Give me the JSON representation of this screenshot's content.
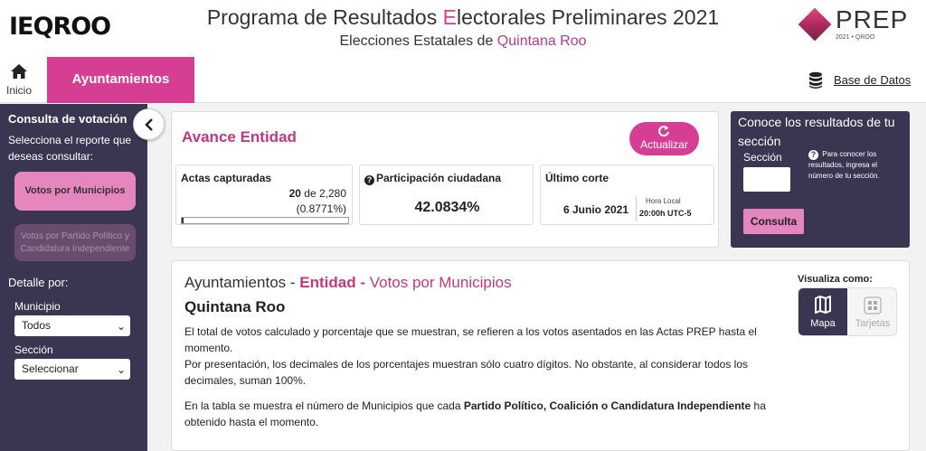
{
  "header": {
    "logo_text": "IEQROO",
    "title_before": "Programa de Resultados ",
    "title_accent": "E",
    "title_after": "lectorales Preliminares 2021",
    "subtitle_before": "Elecciones Estatales de ",
    "subtitle_accent": "Quintana Roo",
    "prep_logo_text": "PREP",
    "prep_logo_year": "2021  •  QROO"
  },
  "navbar": {
    "home_label": "Inicio",
    "active_tab": "Ayuntamientos",
    "database_link": "Base de Datos"
  },
  "sidebar": {
    "title": "Consulta de votación",
    "description": "Selecciona el reporte que deseas consultar:",
    "report_buttons": [
      {
        "label": "Votos por Municipios",
        "active": true
      },
      {
        "label": "Votos por Partido Político y Candidatura Independiente",
        "active": false
      }
    ],
    "detail_label": "Detalle por:",
    "municipio_label": "Municipio",
    "municipio_value": "Todos",
    "seccion_label": "Sección",
    "seccion_value": "Seleccionar"
  },
  "avance": {
    "title": "Avance Entidad",
    "update_button": "Actualizar",
    "actas_label": "Actas capturadas",
    "actas_count": "20",
    "actas_of": " de 2,280",
    "actas_pct": "(0.8771%)",
    "actas_progress": 0.008771,
    "participacion_label": "Participación ciudadana",
    "participacion_value": "42.0834%",
    "corte_label": "Último corte",
    "corte_date": "6 Junio 2021",
    "hora_label": "Hora Local",
    "hora_value": "20:00h UTC-5"
  },
  "conoce": {
    "title": "Conoce los resultados de tu sección",
    "seccion_label": "Sección",
    "help_text": "Para conocer los resultados, ingresa el número de tu sección.",
    "button": "Consulta"
  },
  "main": {
    "heading_prefix": "Ayuntamientos - ",
    "heading_entity": "Entidad",
    "heading_dash": " - ",
    "heading_suffix": "Votos por Municipios",
    "subheading": "Quintana Roo",
    "paragraph1": "El total de votos calculado y porcentaje que se muestran, se refieren a los votos asentados en las Actas PREP hasta el momento.",
    "paragraph1b": "Por presentación, los decimales de los porcentajes muestran sólo cuatro dígitos. No obstante, al considerar todos los decimales, suman 100%.",
    "paragraph2_before": "En la tabla se muestra el número de Municipios que cada ",
    "paragraph2_bold": "Partido Político, Coalición o Candidatura Independiente",
    "paragraph2_after": " ha obtenido hasta el momento.",
    "view_label": "Visualiza como:",
    "view_map": "Mapa",
    "view_cards": "Tarjetas"
  }
}
